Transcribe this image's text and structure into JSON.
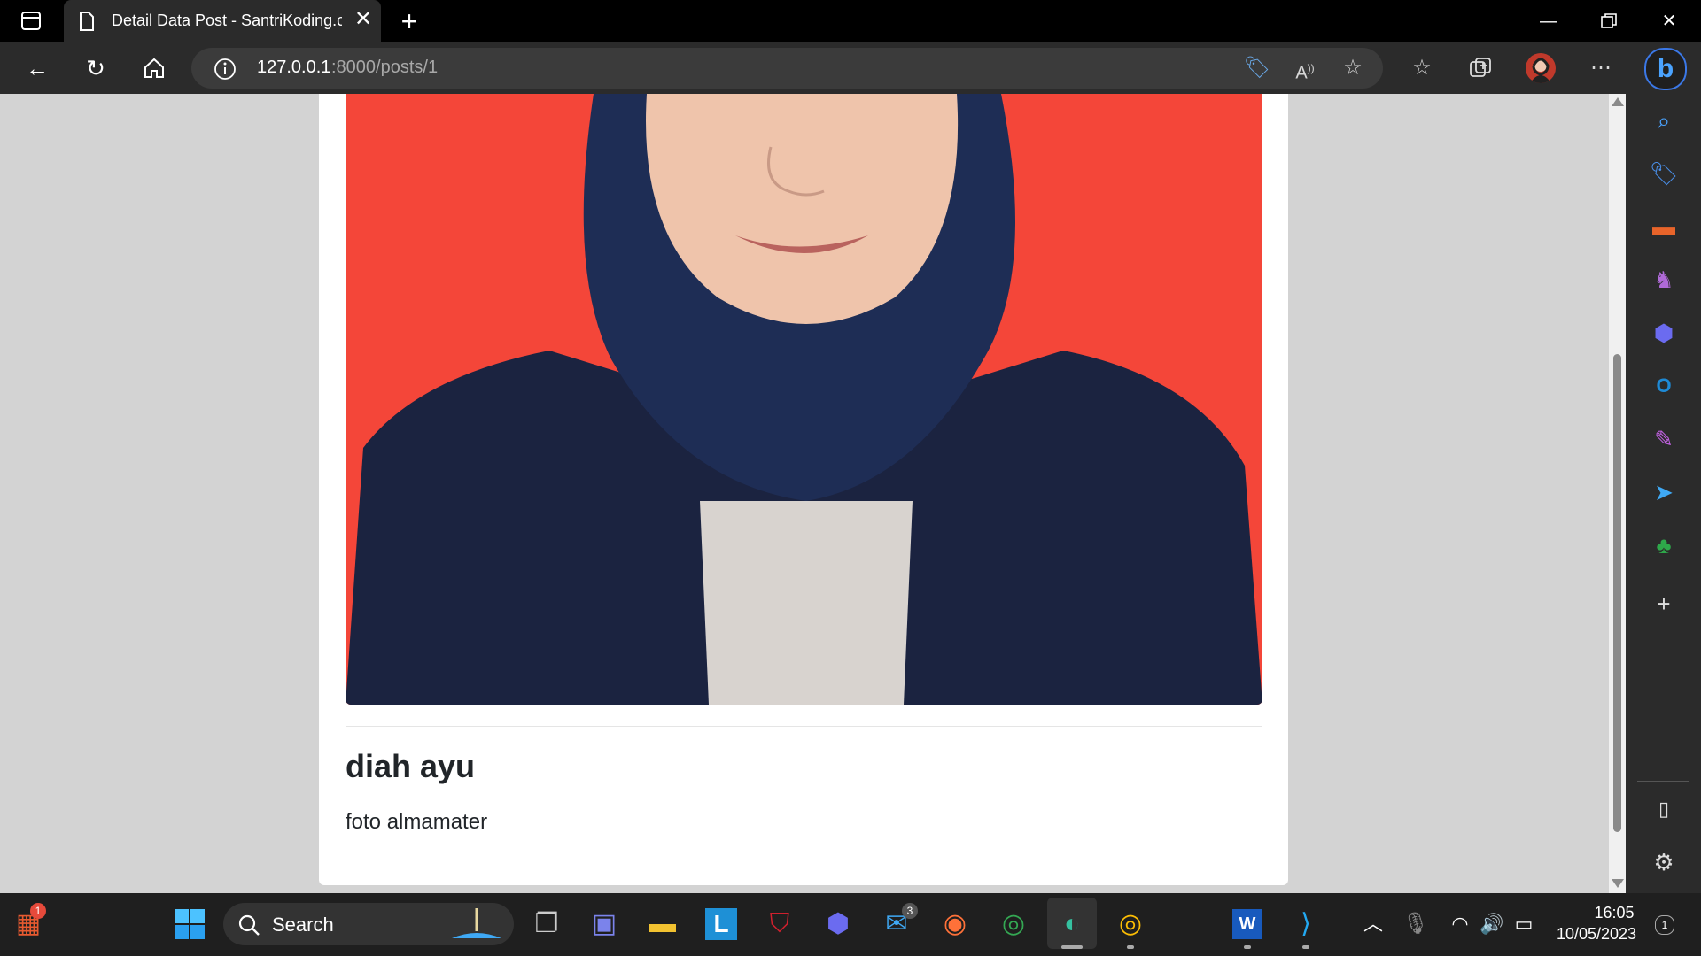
{
  "tab": {
    "title": "Detail Data Post - SantriKoding.com"
  },
  "address": {
    "host": "127.0.0.1",
    "path": ":8000/posts/1"
  },
  "post": {
    "title": "diah ayu",
    "content": "foto almamater"
  },
  "taskbar": {
    "search_label": "Search",
    "clock_time": "16:05",
    "clock_date": "10/05/2023",
    "mail_badge": "3",
    "widget_badge": "1",
    "notification_count": "1"
  },
  "colors": {
    "photo_background": "#f44639",
    "jacket": "#1b2340",
    "hijab": "#1e2d55"
  }
}
